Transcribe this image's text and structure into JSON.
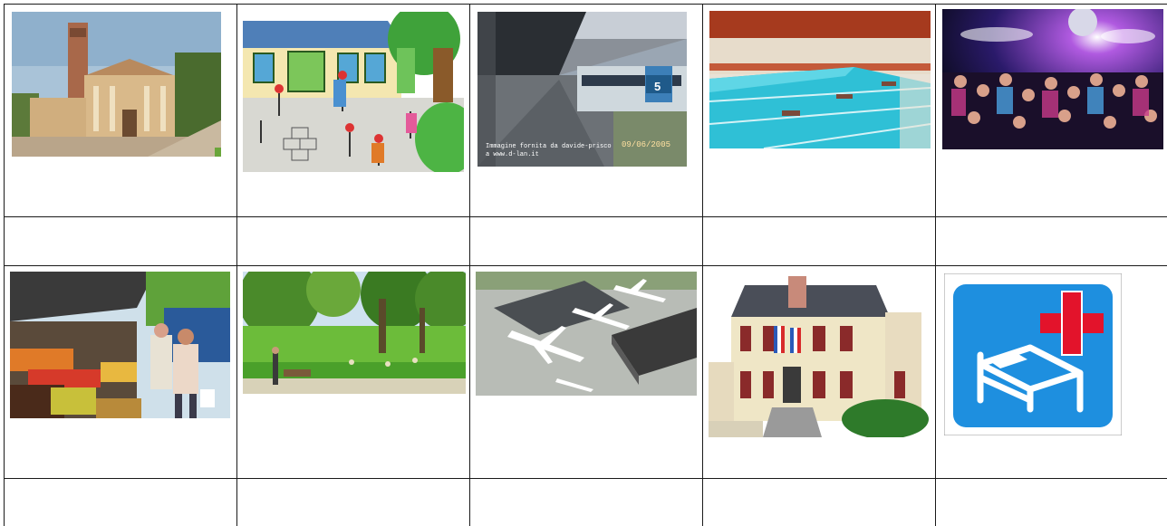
{
  "worksheet": {
    "pictures": [
      {
        "icon": "church-icon"
      },
      {
        "icon": "school-playground-icon"
      },
      {
        "icon": "train-station-icon",
        "caption_lines": [
          "Immagine fornita da davide-prisco",
          "a www.d-lan.it"
        ],
        "date_stamp": "09/06/2005",
        "platform_number": "5"
      },
      {
        "icon": "swimming-pool-icon"
      },
      {
        "icon": "disco-icon"
      },
      {
        "icon": "market-icon"
      },
      {
        "icon": "park-icon"
      },
      {
        "icon": "airport-icon"
      },
      {
        "icon": "town-hall-icon"
      },
      {
        "icon": "hospital-icon"
      }
    ],
    "answer_cells": [
      "",
      "",
      "",
      "",
      "",
      "",
      "",
      "",
      "",
      ""
    ],
    "colors": {
      "grid": "#1a1a1a",
      "hospital_blue": "#1e8fdf",
      "hospital_cross": "#e3132b"
    }
  }
}
